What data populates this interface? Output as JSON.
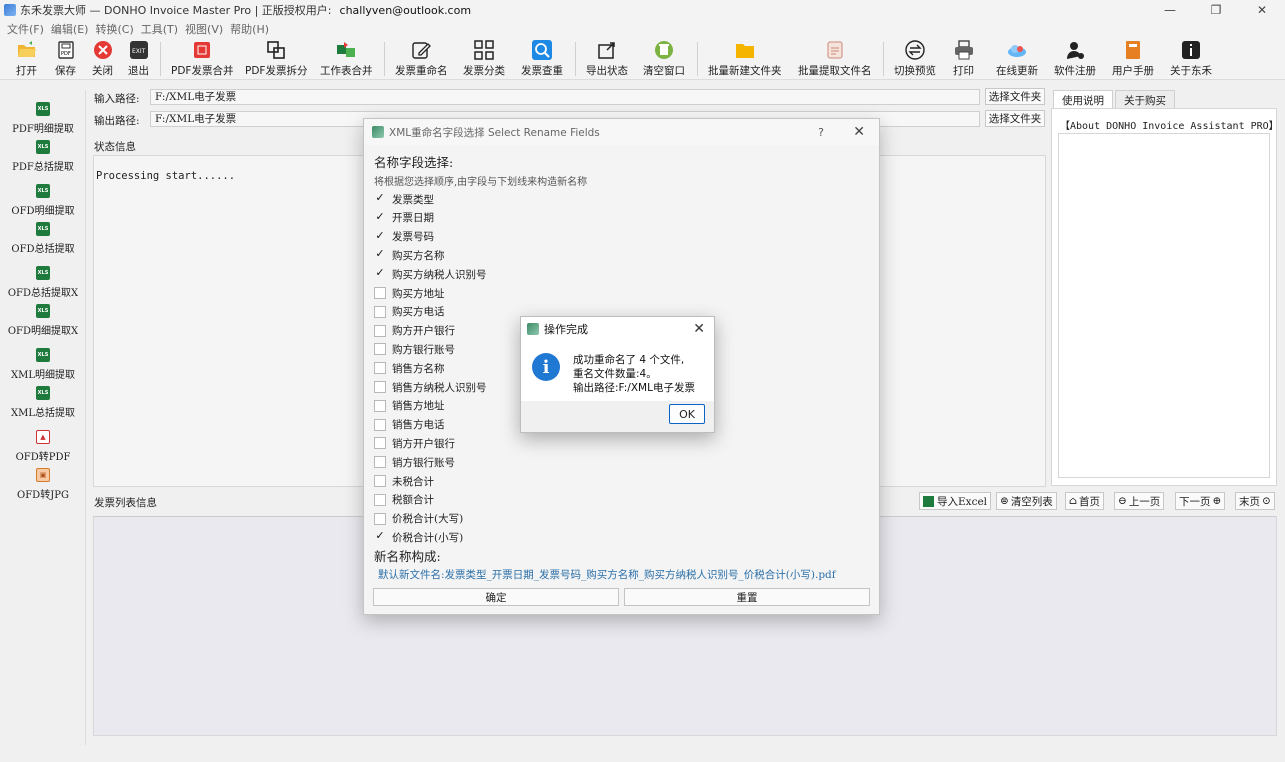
{
  "window": {
    "title": "东禾发票大师 — DONHO Invoice Master Pro | 正版授权用户:",
    "user": "challyven@outlook.com"
  },
  "menu": [
    "文件(F)",
    "编辑(E)",
    "转换(C)",
    "工具(T)",
    "视图(V)",
    "帮助(H)"
  ],
  "toolbar": {
    "open": "打开",
    "save": "保存",
    "close": "关闭",
    "exit": "退出",
    "pdf_merge": "PDF发票合并",
    "pdf_split": "PDF发票拆分",
    "sheet_merge": "工作表合并",
    "rename": "发票重命名",
    "classify": "发票分类",
    "check_dup": "发票查重",
    "export_status": "导出状态",
    "clear_window": "清空窗口",
    "batch_new_folder": "批量新建文件夹",
    "batch_extract_names": "批量提取文件名",
    "toggle_preview": "切换预览",
    "print": "打印",
    "online_update": "在线更新",
    "register": "软件注册",
    "manual": "用户手册",
    "about": "关于东禾"
  },
  "sidebar": [
    {
      "label": "PDF明细提取",
      "icon": "xls"
    },
    {
      "label": "PDF总括提取",
      "icon": "xls"
    },
    {
      "label": "OFD明细提取",
      "icon": "xls"
    },
    {
      "label": "OFD总括提取",
      "icon": "xls"
    },
    {
      "label": "OFD总括提取X",
      "icon": "xls"
    },
    {
      "label": "OFD明细提取X",
      "icon": "xls"
    },
    {
      "label": "XML明细提取",
      "icon": "xls"
    },
    {
      "label": "XML总括提取",
      "icon": "xls"
    },
    {
      "label": "OFD转PDF",
      "icon": "pdf"
    },
    {
      "label": "OFD转JPG",
      "icon": "jpg"
    }
  ],
  "paths": {
    "input_label": "输入路径:",
    "input_value": "F:/XML电子发票",
    "output_label": "输出路径:",
    "output_value": "F:/XML电子发票",
    "choose_folder": "选择文件夹"
  },
  "status": {
    "label": "状态信息",
    "text": "Processing start......"
  },
  "right_tabs": {
    "usage": "使用说明",
    "buy": "关于购买",
    "about_text": "【About DONHO Invoice Assistant PRO】"
  },
  "list": {
    "label": "发票列表信息"
  },
  "nav": {
    "import_excel": "导入Excel",
    "clear_list": "清空列表",
    "home": "首页",
    "prev": "上一页",
    "next": "下一页",
    "last": "末页"
  },
  "rename_dialog": {
    "title": "XML重命名字段选择 Select Rename Fields",
    "help": "?",
    "heading": "名称字段选择:",
    "hint": "将根据您选择顺序,由字段与下划线来构造新名称",
    "fields": [
      {
        "label": "发票类型",
        "checked": true
      },
      {
        "label": "开票日期",
        "checked": true
      },
      {
        "label": "发票号码",
        "checked": true
      },
      {
        "label": "购买方名称",
        "checked": true
      },
      {
        "label": "购买方纳税人识别号",
        "checked": true
      },
      {
        "label": "购买方地址",
        "checked": false
      },
      {
        "label": "购买方电话",
        "checked": false
      },
      {
        "label": "购方开户银行",
        "checked": false
      },
      {
        "label": "购方银行账号",
        "checked": false
      },
      {
        "label": "销售方名称",
        "checked": false
      },
      {
        "label": "销售方纳税人识别号",
        "checked": false
      },
      {
        "label": "销售方地址",
        "checked": false
      },
      {
        "label": "销售方电话",
        "checked": false
      },
      {
        "label": "销方开户银行",
        "checked": false
      },
      {
        "label": "销方银行账号",
        "checked": false
      },
      {
        "label": "未税合计",
        "checked": false
      },
      {
        "label": "税额合计",
        "checked": false
      },
      {
        "label": "价税合计(大写)",
        "checked": false
      },
      {
        "label": "价税合计(小写)",
        "checked": true
      }
    ],
    "new_name_heading": "新名称构成:",
    "preview": "默认新文件名:发票类型_开票日期_发票号码_购买方名称_购买方纳税人识别号_价税合计(小写).pdf",
    "confirm": "确定",
    "reset": "重置"
  },
  "message_box": {
    "title": "操作完成",
    "line1": "成功重命名了 4 个文件,",
    "line2": "重名文件数量:4。",
    "line3": "输出路径:F:/XML电子发票",
    "ok": "OK"
  }
}
